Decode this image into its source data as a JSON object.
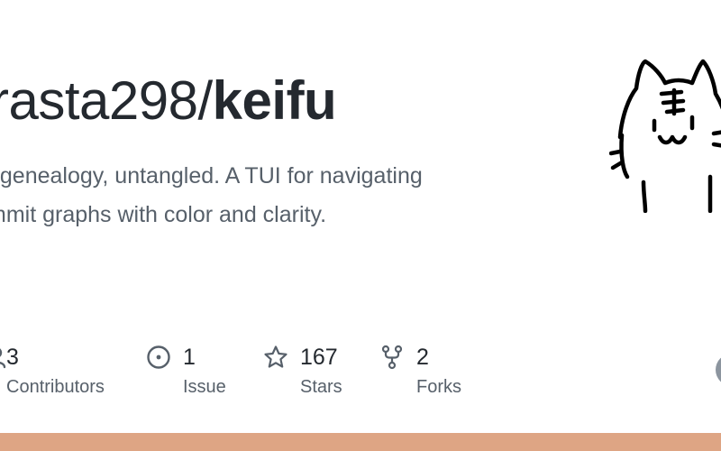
{
  "repo": {
    "owner": "rasta298/",
    "name": "keifu"
  },
  "description": {
    "line1": "t genealogy, untangled. A TUI for navigating",
    "line2": "mmit graphs with color and clarity."
  },
  "stats": [
    {
      "icon": "people-icon",
      "value": "3",
      "label": "Contributors"
    },
    {
      "icon": "issue-icon",
      "value": "1",
      "label": "Issue"
    },
    {
      "icon": "star-icon",
      "value": "167",
      "label": "Stars"
    },
    {
      "icon": "fork-icon",
      "value": "2",
      "label": "Forks"
    }
  ],
  "colors": {
    "language_bar": "#dea584",
    "text_primary": "#24292f",
    "text_secondary": "#57606a"
  }
}
